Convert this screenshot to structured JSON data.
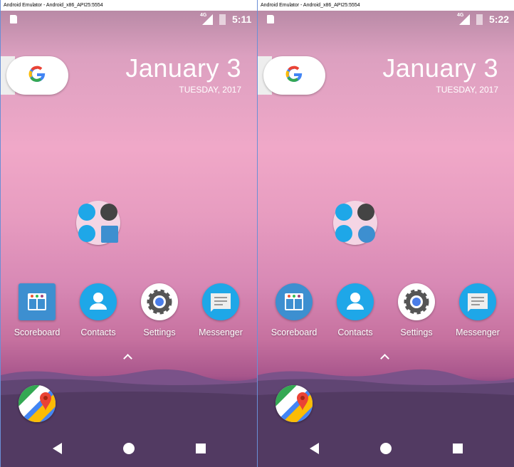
{
  "windows": [
    {
      "title": "Android Emulator - Android_x86_API25:5554",
      "status": {
        "network": "4G",
        "time": "5:11"
      },
      "date": {
        "main": "January 3",
        "sub": "TUESDAY, 2017"
      },
      "apps": [
        {
          "label": "Scoreboard"
        },
        {
          "label": "Contacts"
        },
        {
          "label": "Settings"
        },
        {
          "label": "Messenger"
        }
      ],
      "scoreboard_shape": "square"
    },
    {
      "title": "Android Emulator - Android_x86_API25:5554",
      "status": {
        "network": "4G",
        "time": "5:22"
      },
      "date": {
        "main": "January 3",
        "sub": "TUESDAY, 2017"
      },
      "apps": [
        {
          "label": "Scoreboard"
        },
        {
          "label": "Contacts"
        },
        {
          "label": "Settings"
        },
        {
          "label": "Messenger"
        }
      ],
      "scoreboard_shape": "circle"
    }
  ],
  "icons": [
    "sd-card-icon",
    "signal-icon",
    "battery-icon",
    "google-icon",
    "folder-icon",
    "scoreboard-icon",
    "contacts-icon",
    "settings-icon",
    "messenger-icon",
    "maps-icon",
    "back-icon",
    "home-icon",
    "recents-icon",
    "chevron-up-icon"
  ],
  "colors": {
    "accent": "#1ea7e8",
    "google_blue": "#4285f4"
  }
}
